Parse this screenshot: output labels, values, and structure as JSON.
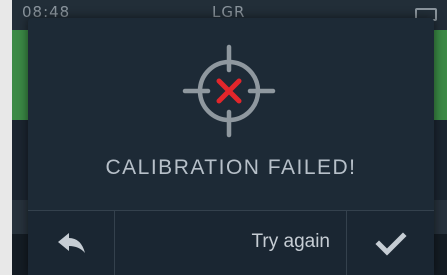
{
  "status_bar": {
    "time": "08:48",
    "title": "LGR"
  },
  "dialog": {
    "icon": "calibration-target-failed-icon",
    "message": "CALIBRATION FAILED!",
    "buttons": {
      "back_icon": "back-arrow-icon",
      "try_again_label": "Try again",
      "confirm_icon": "checkmark-icon"
    }
  },
  "colors": {
    "dialog_background": "#1d2a36",
    "error_red": "#e2262b",
    "icon_grey": "#8f989f",
    "text": "#b7c0c9",
    "background_green": "#3b8a45"
  }
}
